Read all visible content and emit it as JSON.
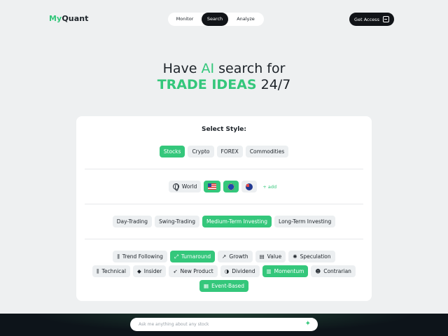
{
  "brand": {
    "part1": "My",
    "part2": "Quant"
  },
  "nav": {
    "tabs": [
      {
        "label": "Monitor"
      },
      {
        "label": "Search"
      },
      {
        "label": "Analyze"
      }
    ],
    "active": "Search"
  },
  "cta": {
    "label": "Get Access",
    "icon": "login-icon"
  },
  "hero": {
    "line1_pre": "Have ",
    "line1_ai": "AI",
    "line1_post": " search for",
    "line2_highlight": "TRADE IDEAS",
    "line2_post": " 24/7"
  },
  "style_panel": {
    "title": "Select Style:",
    "asset_classes": [
      {
        "label": "Stocks",
        "selected": true
      },
      {
        "label": "Crypto",
        "selected": false
      },
      {
        "label": "FOREX",
        "selected": false
      },
      {
        "label": "Commodities",
        "selected": false
      }
    ],
    "regions": [
      {
        "label": "World",
        "icon": "globe-icon",
        "selected": false
      },
      {
        "label": "",
        "icon": "us-flag-icon",
        "selected": true
      },
      {
        "label": "",
        "icon": "eu-flag-icon",
        "selected": true
      },
      {
        "label": "",
        "icon": "australia-flag-icon",
        "selected": false
      }
    ],
    "add_region_label": "+ add",
    "horizons": [
      {
        "label": "Day-Trading",
        "selected": false
      },
      {
        "label": "Swing-Trading",
        "selected": false
      },
      {
        "label": "Medium-Term Investing",
        "selected": true
      },
      {
        "label": "Long-Term Investing",
        "selected": false
      }
    ],
    "strategies_row1": [
      {
        "label": "Trend Following",
        "icon": "candlestick-icon",
        "glyph": "⫼",
        "selected": false
      },
      {
        "label": "Turnaround",
        "icon": "turnaround-icon",
        "glyph": "⤢",
        "selected": true
      },
      {
        "label": "Growth",
        "icon": "growth-icon",
        "glyph": "↗",
        "selected": false
      },
      {
        "label": "Value",
        "icon": "value-icon",
        "glyph": "▤",
        "selected": false
      },
      {
        "label": "Speculation",
        "icon": "speculation-icon",
        "glyph": "✺",
        "selected": false
      }
    ],
    "strategies_row2": [
      {
        "label": "Technical",
        "icon": "candlestick-icon",
        "glyph": "⫼",
        "selected": false
      },
      {
        "label": "Insider",
        "icon": "insider-icon",
        "glyph": "◆",
        "selected": false
      },
      {
        "label": "New Product",
        "icon": "rocket-icon",
        "glyph": "➶",
        "selected": false
      },
      {
        "label": "Dividend",
        "icon": "dividend-icon",
        "glyph": "◑",
        "selected": false
      },
      {
        "label": "Momentum",
        "icon": "bar-chart-icon",
        "glyph": "▥",
        "selected": true
      },
      {
        "label": "Contrarian",
        "icon": "contrarian-icon",
        "glyph": "☻",
        "selected": false
      }
    ],
    "strategies_row3": [
      {
        "label": "Event-Based",
        "icon": "calendar-icon",
        "glyph": "▦",
        "selected": true
      }
    ]
  },
  "ask_bar": {
    "placeholder": "Ask me anything about any stock",
    "icon": "sparkle-icon"
  },
  "colors": {
    "accent": "#34c77b",
    "dark": "#111418",
    "background": "#eef0f1"
  }
}
